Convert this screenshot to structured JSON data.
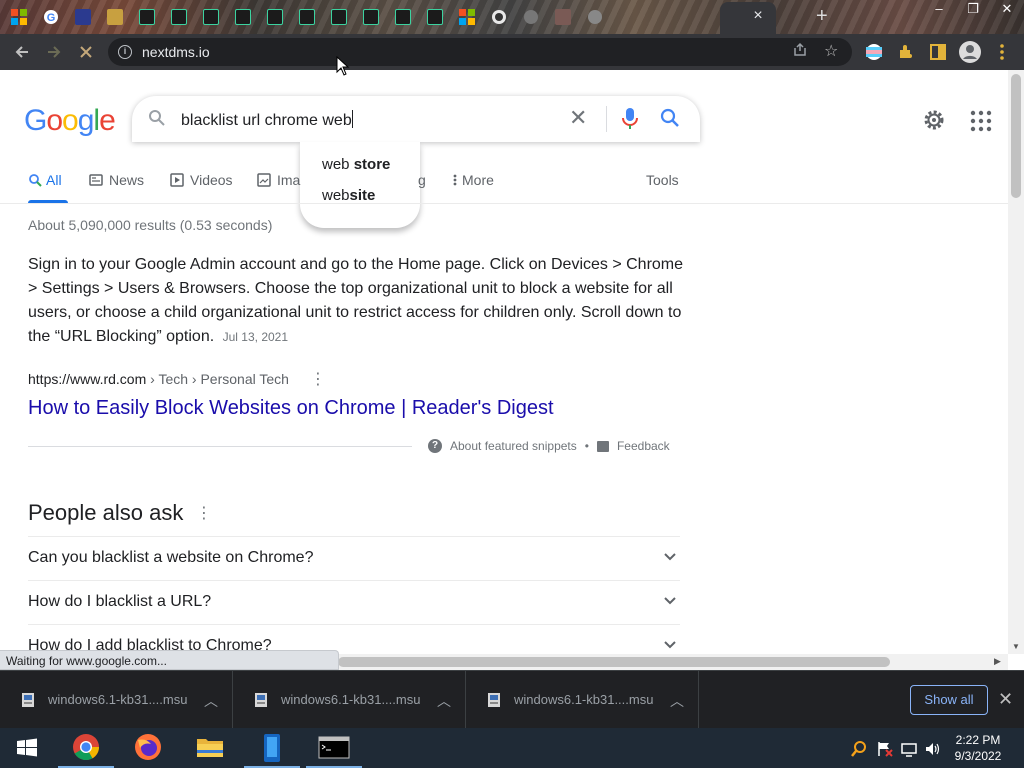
{
  "browser": {
    "url": "nextdms.io",
    "tab_close_glyph": "×",
    "new_tab_glyph": "+"
  },
  "google": {
    "logo": "Google",
    "query": "blacklist url chrome web",
    "suggestions": [
      {
        "prefix": "web",
        "completion": " store"
      },
      {
        "prefix": "web",
        "completion": "site"
      }
    ],
    "tabs": [
      "All",
      "News",
      "Videos",
      "Ima",
      "g",
      "More"
    ],
    "tools_label": "Tools",
    "stats": "About 5,090,000 results (0.53 seconds)",
    "snippet_text": "Sign in to your Google Admin account and go to the Home page. Click on Devices > Chrome > Settings > Users & Browsers. Choose the top organizational unit to block a website for all users, or choose a child organizational unit to restrict access for children only. Scroll down to the “URL Blocking” option.",
    "snippet_date": "Jul 13, 2021",
    "result_url_base": "https://www.rd.com",
    "result_url_path": " › Tech › Personal Tech",
    "result_title": "How to Easily Block Websites on Chrome | Reader's Digest",
    "about_snippets": "About featured snippets",
    "bullet": "•",
    "feedback": "Feedback",
    "paa_title": "People also ask",
    "paa_questions": [
      "Can you blacklist a website on Chrome?",
      "How do I blacklist a URL?",
      "How do I add blacklist to Chrome?"
    ]
  },
  "status_text": "Waiting for www.google.com...",
  "downloads": {
    "items": [
      "windows6.1-kb31....msu",
      "windows6.1-kb31....msu",
      "windows6.1-kb31....msu"
    ],
    "show_all": "Show all"
  },
  "taskbar": {
    "time": "2:22 PM",
    "date": "9/3/2022"
  },
  "colors": {
    "link": "#1a0dab",
    "accent": "#1a73e8",
    "chrome_toolbar": "#35363a",
    "taskbar": "#1f2a36"
  }
}
